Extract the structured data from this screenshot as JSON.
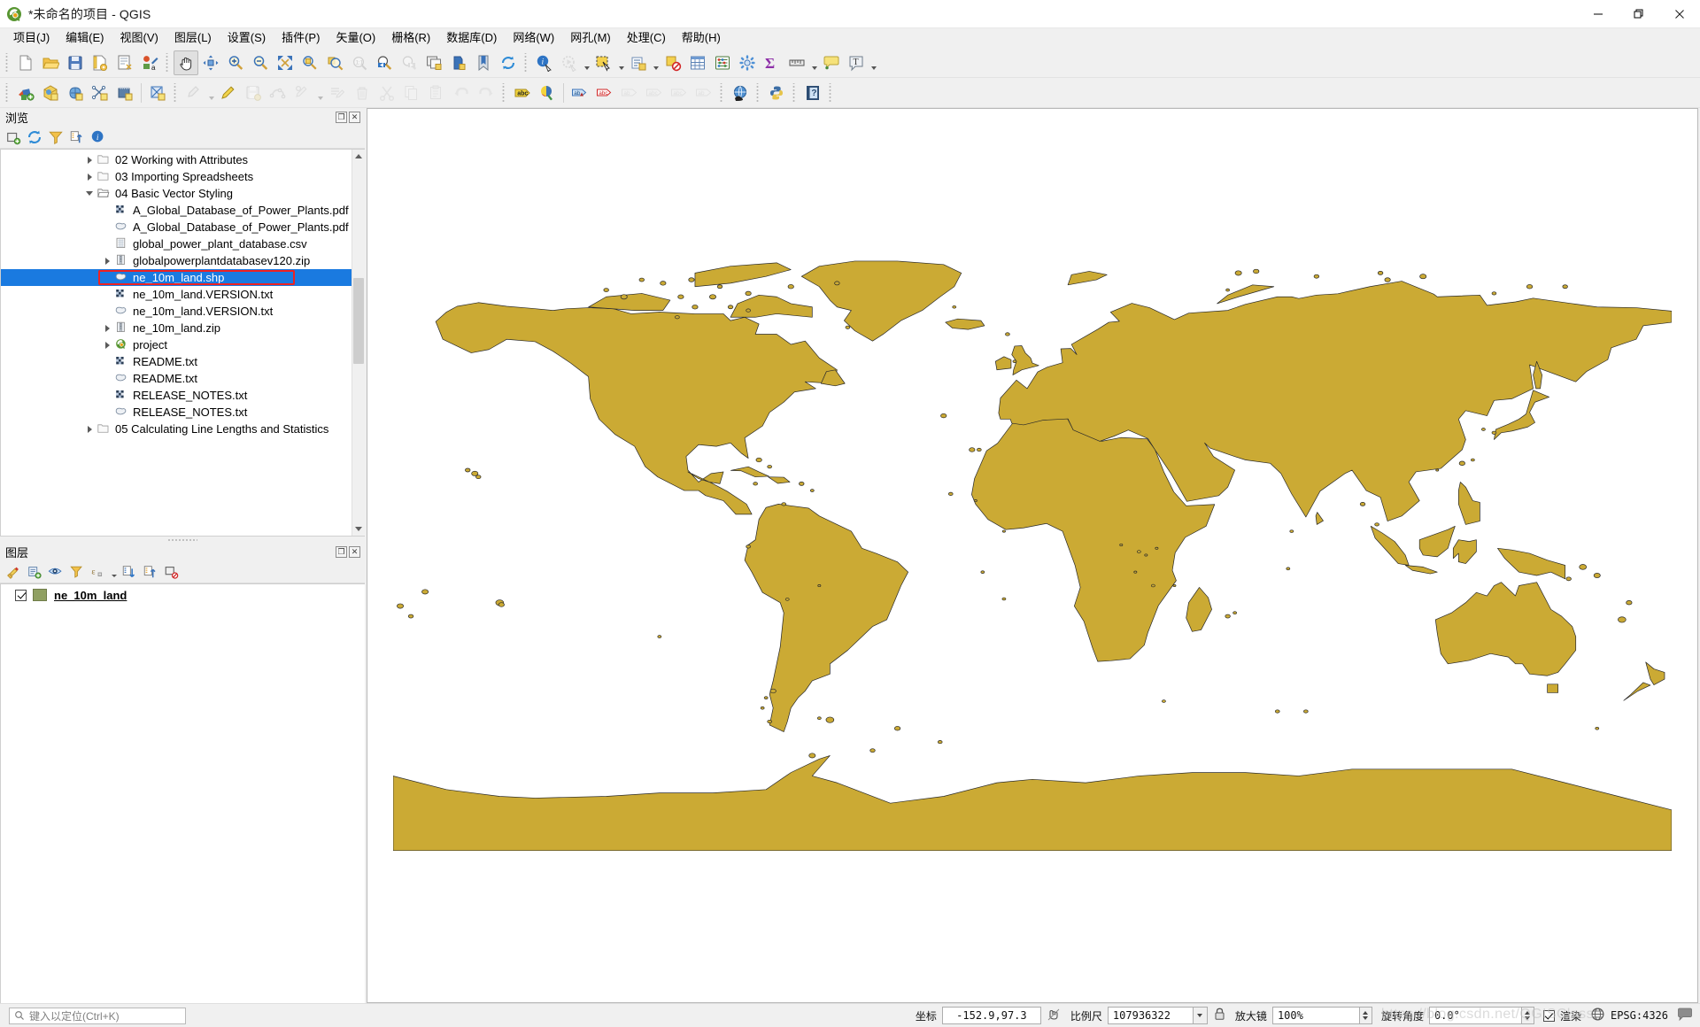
{
  "window": {
    "title": "*未命名的项目 - QGIS",
    "logo_icon": "qgis-logo-icon",
    "minimize_label": "—",
    "maximize_label": "❐",
    "close_label": "✕"
  },
  "menubar": {
    "items": [
      {
        "label": "项目(J)",
        "name": "menu-project"
      },
      {
        "label": "编辑(E)",
        "name": "menu-edit"
      },
      {
        "label": "视图(V)",
        "name": "menu-view"
      },
      {
        "label": "图层(L)",
        "name": "menu-layer"
      },
      {
        "label": "设置(S)",
        "name": "menu-settings"
      },
      {
        "label": "插件(P)",
        "name": "menu-plugins"
      },
      {
        "label": "矢量(O)",
        "name": "menu-vector"
      },
      {
        "label": "栅格(R)",
        "name": "menu-raster"
      },
      {
        "label": "数据库(D)",
        "name": "menu-database"
      },
      {
        "label": "网络(W)",
        "name": "menu-web"
      },
      {
        "label": "网孔(M)",
        "name": "menu-mesh"
      },
      {
        "label": "处理(C)",
        "name": "menu-processing"
      },
      {
        "label": "帮助(H)",
        "name": "menu-help"
      }
    ]
  },
  "toolbar_row1": {
    "groups": [
      {
        "type": "grip"
      },
      {
        "type": "btn",
        "icon": "new-project-icon",
        "tooltip": "新建项目"
      },
      {
        "type": "btn",
        "icon": "open-project-icon",
        "tooltip": "打开项目"
      },
      {
        "type": "btn",
        "icon": "save-project-icon",
        "tooltip": "保存项目"
      },
      {
        "type": "btn",
        "icon": "save-project-as-icon",
        "tooltip": "项目另存为"
      },
      {
        "type": "btn",
        "icon": "new-print-layout-icon",
        "tooltip": "新建打印布局"
      },
      {
        "type": "btn",
        "icon": "style-manager-icon",
        "tooltip": "样式管理器"
      },
      {
        "type": "grip"
      },
      {
        "type": "btn",
        "icon": "pan-map-icon",
        "tooltip": "平移地图",
        "checked": true
      },
      {
        "type": "btn",
        "icon": "pan-to-selection-icon",
        "tooltip": "平移地图到选择集"
      },
      {
        "type": "btn",
        "icon": "zoom-in-icon",
        "tooltip": "放大"
      },
      {
        "type": "btn",
        "icon": "zoom-out-icon",
        "tooltip": "缩小"
      },
      {
        "type": "btn",
        "icon": "zoom-full-icon",
        "tooltip": "全图缩放"
      },
      {
        "type": "btn",
        "icon": "zoom-to-selection-icon",
        "tooltip": "缩放到选择集"
      },
      {
        "type": "btn",
        "icon": "zoom-to-layer-icon",
        "tooltip": "缩放到图层"
      },
      {
        "type": "btn",
        "icon": "zoom-native-icon",
        "tooltip": "缩放到原始分辨率",
        "disabled": true
      },
      {
        "type": "btn",
        "icon": "zoom-last-icon",
        "tooltip": "上一次视图"
      },
      {
        "type": "btn",
        "icon": "zoom-next-icon",
        "tooltip": "下一次视图",
        "disabled": true
      },
      {
        "type": "btn",
        "icon": "new-map-view-icon",
        "tooltip": "新建地图视图"
      },
      {
        "type": "btn",
        "icon": "new-3d-map-view-icon",
        "tooltip": "新建3D地图视图"
      },
      {
        "type": "btn",
        "icon": "bookmarks-icon",
        "tooltip": "显示书签"
      },
      {
        "type": "btn",
        "icon": "refresh-icon",
        "tooltip": "刷新"
      },
      {
        "type": "grip"
      },
      {
        "type": "btn",
        "icon": "identify-features-icon",
        "tooltip": "识别要素"
      },
      {
        "type": "btn",
        "icon": "run-feature-action-icon",
        "tooltip": "运行要素动作",
        "disabled": true
      },
      {
        "type": "arrow"
      },
      {
        "type": "btn",
        "icon": "select-features-icon",
        "tooltip": "选择要素"
      },
      {
        "type": "arrow"
      },
      {
        "type": "btn",
        "icon": "select-by-value-icon",
        "tooltip": "按值选择"
      },
      {
        "type": "arrow"
      },
      {
        "type": "btn",
        "icon": "deselect-features-icon",
        "tooltip": "取消选择所有要素"
      },
      {
        "type": "btn",
        "icon": "open-attribute-table-icon",
        "tooltip": "打开属性表"
      },
      {
        "type": "btn",
        "icon": "field-calculator-icon",
        "tooltip": "字段计算器"
      },
      {
        "type": "btn",
        "icon": "processing-toolbox-icon",
        "tooltip": "处理工具箱"
      },
      {
        "type": "btn",
        "icon": "statistical-summary-icon",
        "tooltip": "统计汇总"
      },
      {
        "type": "btn",
        "icon": "measure-line-icon",
        "tooltip": "测量线"
      },
      {
        "type": "arrow"
      },
      {
        "type": "btn",
        "icon": "map-tips-icon",
        "tooltip": "地图提示"
      },
      {
        "type": "btn",
        "icon": "text-annotation-icon",
        "tooltip": "文本注记"
      },
      {
        "type": "arrow"
      }
    ]
  },
  "toolbar_row2": {
    "groups": [
      {
        "type": "grip"
      },
      {
        "type": "btn",
        "icon": "open-data-source-manager-icon",
        "tooltip": "打开数据源管理器"
      },
      {
        "type": "btn",
        "icon": "add-vector-layer-icon",
        "tooltip": "添加矢量图层"
      },
      {
        "type": "btn",
        "icon": "add-raster-layer-icon",
        "tooltip": "添加栅格图层"
      },
      {
        "type": "btn",
        "icon": "add-mesh-layer-icon",
        "tooltip": "添加网孔图层"
      },
      {
        "type": "btn",
        "icon": "add-delimited-text-layer-icon",
        "tooltip": "添加分隔文本图层"
      },
      {
        "type": "sep"
      },
      {
        "type": "btn",
        "icon": "new-shapefile-layer-icon",
        "tooltip": "新建Shapefile图层"
      },
      {
        "type": "grip"
      },
      {
        "type": "btn",
        "icon": "current-edits-icon",
        "tooltip": "当前编辑",
        "disabled": true
      },
      {
        "type": "arrow",
        "disabled": true
      },
      {
        "type": "btn",
        "icon": "toggle-editing-icon",
        "tooltip": "切换编辑模式"
      },
      {
        "type": "btn",
        "icon": "save-layer-edits-icon",
        "tooltip": "保存图层编辑",
        "disabled": true
      },
      {
        "type": "btn",
        "icon": "vertex-tool-icon",
        "tooltip": "顶点工具",
        "disabled": true
      },
      {
        "type": "btn",
        "icon": "modify-attributes-icon",
        "tooltip": "修改要素属性",
        "disabled": true
      },
      {
        "type": "arrow",
        "disabled": true
      },
      {
        "type": "btn",
        "icon": "multi-edit-icon",
        "tooltip": "多重编辑",
        "disabled": true
      },
      {
        "type": "btn",
        "icon": "delete-selected-icon",
        "tooltip": "删除选中要素",
        "disabled": true
      },
      {
        "type": "btn",
        "icon": "cut-features-icon",
        "tooltip": "剪切要素",
        "disabled": true
      },
      {
        "type": "btn",
        "icon": "copy-features-icon",
        "tooltip": "复制要素",
        "disabled": true
      },
      {
        "type": "btn",
        "icon": "paste-features-icon",
        "tooltip": "粘贴要素",
        "disabled": true
      },
      {
        "type": "btn",
        "icon": "undo-icon",
        "tooltip": "撤销",
        "disabled": true
      },
      {
        "type": "btn",
        "icon": "redo-icon",
        "tooltip": "重做",
        "disabled": true
      },
      {
        "type": "grip"
      },
      {
        "type": "btn",
        "icon": "label-layer-icon",
        "tooltip": "图层标注"
      },
      {
        "type": "btn",
        "icon": "layer-styling-icon",
        "tooltip": "图层样式"
      },
      {
        "type": "sep"
      },
      {
        "type": "btn",
        "icon": "highlight-pinned-labels-icon",
        "tooltip": "高亮锁定标注"
      },
      {
        "type": "btn",
        "icon": "pin-labels-icon",
        "tooltip": "锁定/解锁标注"
      },
      {
        "type": "btn",
        "icon": "show-hide-labels-icon",
        "tooltip": "显示/隐藏标注",
        "disabled": true
      },
      {
        "type": "btn",
        "icon": "move-label-icon",
        "tooltip": "移动标注",
        "disabled": true
      },
      {
        "type": "btn",
        "icon": "rotate-label-icon",
        "tooltip": "旋转标注",
        "disabled": true
      },
      {
        "type": "btn",
        "icon": "change-label-icon",
        "tooltip": "更改标注",
        "disabled": true
      },
      {
        "type": "grip"
      },
      {
        "type": "btn",
        "icon": "metasearch-globe-icon",
        "tooltip": "MetaSearch"
      },
      {
        "type": "grip"
      },
      {
        "type": "btn",
        "icon": "python-console-icon",
        "tooltip": "Python控制台"
      },
      {
        "type": "grip"
      },
      {
        "type": "btn",
        "icon": "help-icon",
        "tooltip": "帮助"
      },
      {
        "type": "grip"
      }
    ]
  },
  "browser_panel": {
    "title": "浏览",
    "float_label": "❐",
    "close_label": "✕",
    "toolbar": [
      {
        "icon": "add-layer-icon",
        "name": "browser-add-selected-layers-button"
      },
      {
        "icon": "refresh-icon",
        "name": "browser-refresh-button"
      },
      {
        "icon": "filter-icon",
        "name": "browser-filter-button"
      },
      {
        "icon": "collapse-all-icon",
        "name": "browser-collapse-all-button"
      },
      {
        "icon": "info-icon",
        "name": "browser-properties-button"
      }
    ],
    "tree": [
      {
        "label": "02 Working with Attributes",
        "icon": "folder-icon",
        "indent": 2,
        "expander": "collapsed",
        "selected": false
      },
      {
        "label": "03 Importing Spreadsheets",
        "icon": "folder-icon",
        "indent": 2,
        "expander": "collapsed",
        "selected": false
      },
      {
        "label": "04 Basic Vector Styling",
        "icon": "folder-open-icon",
        "indent": 2,
        "expander": "expanded",
        "selected": false
      },
      {
        "label": "A_Global_Database_of_Power_Plants.pdf",
        "icon": "raster-layer-icon",
        "indent": 3,
        "expander": "none",
        "selected": false
      },
      {
        "label": "A_Global_Database_of_Power_Plants.pdf",
        "icon": "vector-polygon-icon",
        "indent": 3,
        "expander": "none",
        "selected": false
      },
      {
        "label": "global_power_plant_database.csv",
        "icon": "csv-table-icon",
        "indent": 3,
        "expander": "none",
        "selected": false
      },
      {
        "label": "globalpowerplantdatabasev120.zip",
        "icon": "zip-archive-icon",
        "indent": 3,
        "expander": "collapsed",
        "selected": false
      },
      {
        "label": "ne_10m_land.shp",
        "icon": "vector-polygon-icon",
        "indent": 3,
        "expander": "none",
        "selected": true
      },
      {
        "label": "ne_10m_land.VERSION.txt",
        "icon": "raster-layer-icon",
        "indent": 3,
        "expander": "none",
        "selected": false
      },
      {
        "label": "ne_10m_land.VERSION.txt",
        "icon": "vector-polygon-icon",
        "indent": 3,
        "expander": "none",
        "selected": false
      },
      {
        "label": "ne_10m_land.zip",
        "icon": "zip-archive-icon",
        "indent": 3,
        "expander": "collapsed",
        "selected": false
      },
      {
        "label": "project",
        "icon": "qgis-project-icon",
        "indent": 3,
        "expander": "collapsed",
        "selected": false
      },
      {
        "label": "README.txt",
        "icon": "raster-layer-icon",
        "indent": 3,
        "expander": "none",
        "selected": false
      },
      {
        "label": "README.txt",
        "icon": "vector-polygon-icon",
        "indent": 3,
        "expander": "none",
        "selected": false
      },
      {
        "label": "RELEASE_NOTES.txt",
        "icon": "raster-layer-icon",
        "indent": 3,
        "expander": "none",
        "selected": false
      },
      {
        "label": "RELEASE_NOTES.txt",
        "icon": "vector-polygon-icon",
        "indent": 3,
        "expander": "none",
        "selected": false
      },
      {
        "label": "05 Calculating Line Lengths and Statistics",
        "icon": "folder-icon",
        "indent": 2,
        "expander": "collapsed",
        "selected": false
      }
    ]
  },
  "layers_panel": {
    "title": "图层",
    "float_label": "❐",
    "close_label": "✕",
    "toolbar": [
      {
        "icon": "open-layer-styling-panel-icon",
        "name": "layers-styling-panel-button"
      },
      {
        "icon": "add-group-icon",
        "name": "layers-add-group-button"
      },
      {
        "icon": "manage-visibility-icon",
        "name": "layers-manage-visibility-button"
      },
      {
        "icon": "filter-legend-icon",
        "name": "layers-filter-legend-button"
      },
      {
        "icon": "expression-filter-icon",
        "name": "layers-expression-filter-button"
      },
      {
        "icon": "expand-all-icon",
        "name": "layers-expand-all-button"
      },
      {
        "icon": "collapse-all-icon",
        "name": "layers-collapse-all-button"
      },
      {
        "icon": "remove-layer-icon",
        "name": "layers-remove-button"
      }
    ],
    "layers": [
      {
        "name": "ne_10m_land",
        "checked": true,
        "swatch_color": "#90a062"
      }
    ]
  },
  "map": {
    "land_fill": "#cbaa34",
    "land_stroke": "#2a2a2a",
    "background": "#ffffff",
    "watermark": "https://blog.csdn.net/QGISClass"
  },
  "statusbar": {
    "locator_placeholder": "键入以定位(Ctrl+K)",
    "locator_icon": "search-icon",
    "coordinate_label": "坐标",
    "coordinate_value": "-152.9,97.3",
    "extent_toggle_icon": "toggle-extents-icon",
    "scale_label": "比例尺",
    "scale_value": "107936322",
    "lock_icon": "lock-scale-icon",
    "magnifier_label": "放大镜",
    "magnifier_value": "100%",
    "rotation_label": "旋转角度",
    "rotation_value": "0.0°",
    "render_label": "渲染",
    "render_checked": true,
    "crs_icon": "crs-globe-icon",
    "crs_label": "EPSG:4326",
    "messages_icon": "messages-icon"
  }
}
